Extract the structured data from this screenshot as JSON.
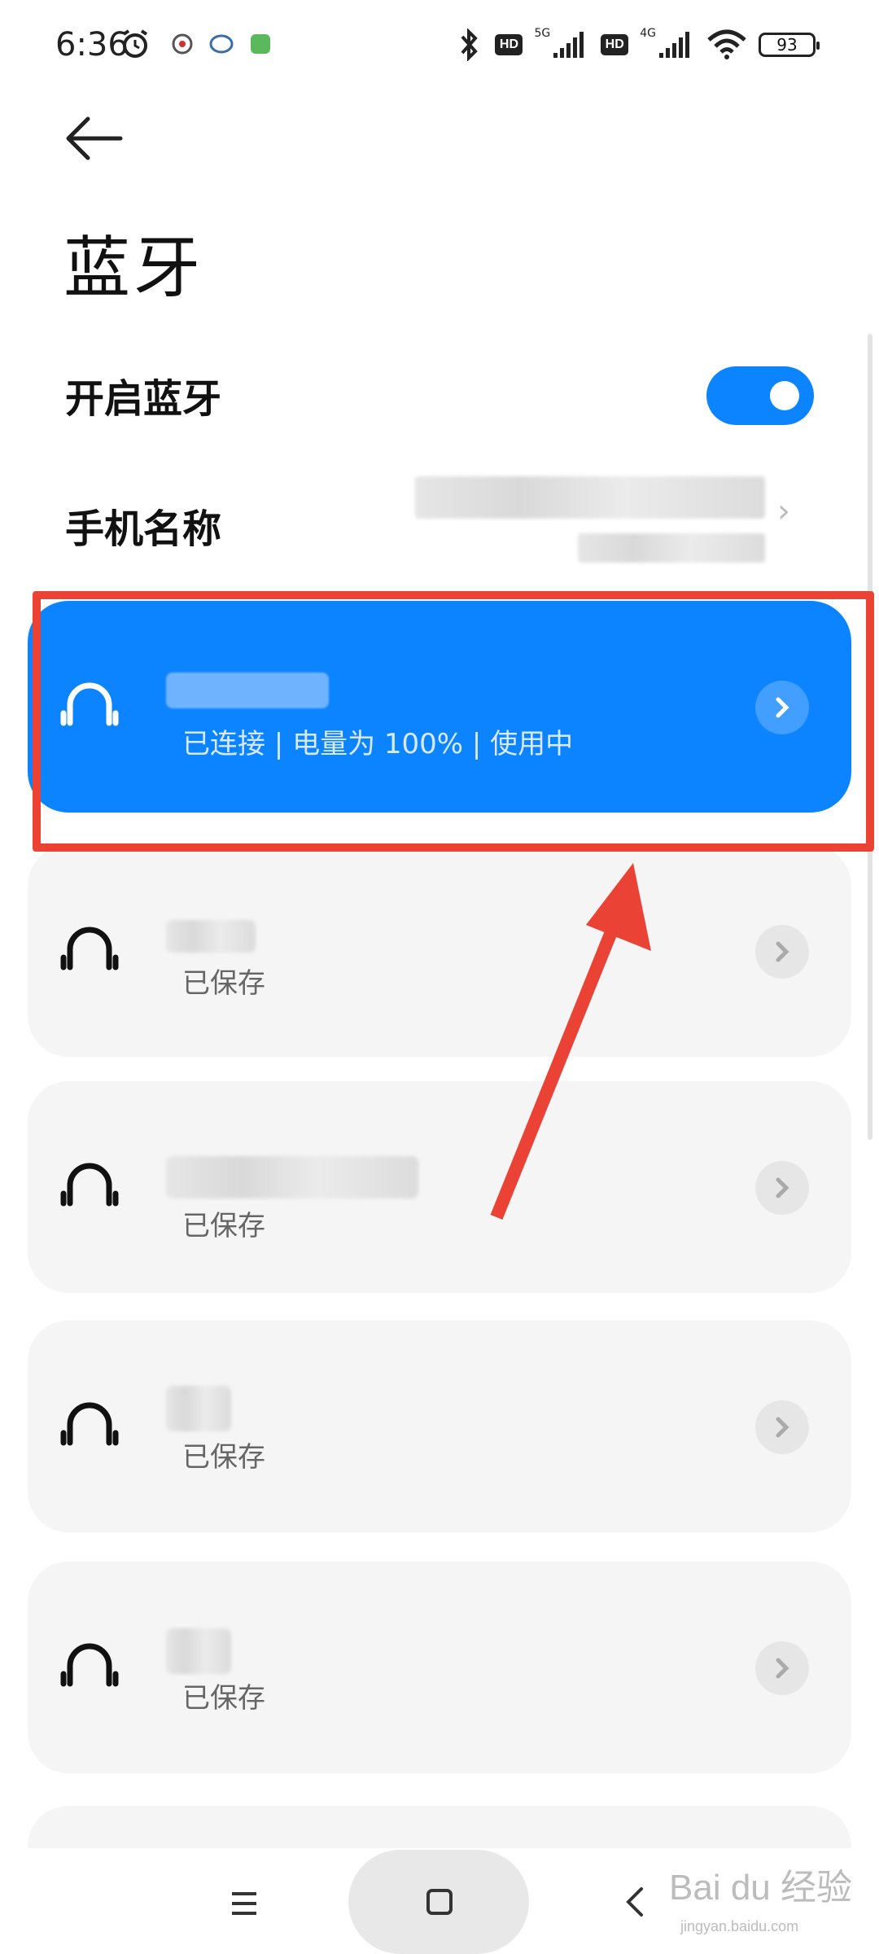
{
  "status_bar": {
    "time": "6:36",
    "net_5g": "5G",
    "net_4g": "4G",
    "hd_1": "HD",
    "hd_2": "HD",
    "battery": "93"
  },
  "header": {
    "title": "蓝牙"
  },
  "settings": {
    "bluetooth_toggle_label": "开启蓝牙",
    "bluetooth_enabled": true,
    "phone_name_label": "手机名称"
  },
  "devices": [
    {
      "status": "已连接 | 电量为 100% | 使用中",
      "connected": true
    },
    {
      "status": "已保存",
      "connected": false
    },
    {
      "status": "已保存",
      "connected": false
    },
    {
      "status": "已保存",
      "connected": false
    },
    {
      "status": "已保存",
      "connected": false
    }
  ],
  "watermark": {
    "text": "Bai du 经验",
    "sub": "jingyan.baidu.com"
  },
  "colors": {
    "accent": "#0d84ff",
    "annotation": "#ea4335",
    "card_bg": "#f5f5f5"
  }
}
